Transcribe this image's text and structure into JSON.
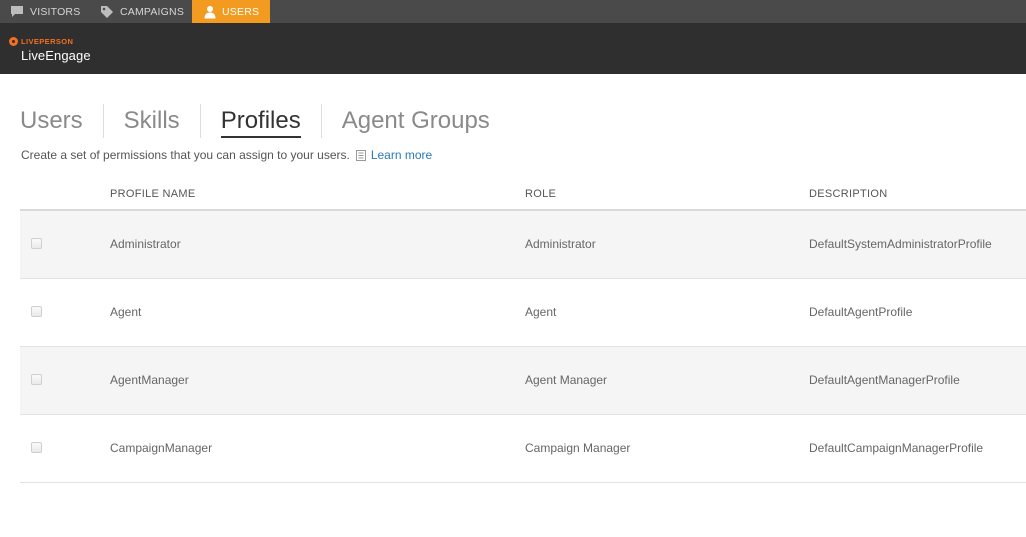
{
  "topnav": {
    "items": [
      {
        "label": "VISITORS",
        "icon": "speech-bubble-icon",
        "active": false
      },
      {
        "label": "CAMPAIGNS",
        "icon": "tag-icon",
        "active": false
      },
      {
        "label": "USERS",
        "icon": "person-icon",
        "active": true
      }
    ],
    "active_color": "#f39a21"
  },
  "brand": {
    "company": "LIVEPERSON",
    "product": "LiveEngage",
    "accent": "#f36f21"
  },
  "tabs": [
    {
      "label": "Users",
      "active": false
    },
    {
      "label": "Skills",
      "active": false
    },
    {
      "label": "Profiles",
      "active": true
    },
    {
      "label": "Agent Groups",
      "active": false
    }
  ],
  "subtitle": {
    "text": "Create a set of permissions that you can assign to your users.",
    "link": "Learn more",
    "link_icon": "document-icon"
  },
  "table": {
    "columns": {
      "name": "PROFILE NAME",
      "role": "ROLE",
      "description": "DESCRIPTION"
    },
    "rows": [
      {
        "name": "Administrator",
        "role": "Administrator",
        "description": "DefaultSystemAdministratorProfile",
        "checked": false
      },
      {
        "name": "Agent",
        "role": "Agent",
        "description": "DefaultAgentProfile",
        "checked": false
      },
      {
        "name": "AgentManager",
        "role": "Agent Manager",
        "description": "DefaultAgentManagerProfile",
        "checked": false
      },
      {
        "name": "CampaignManager",
        "role": "Campaign Manager",
        "description": "DefaultCampaignManagerProfile",
        "checked": false
      }
    ]
  }
}
